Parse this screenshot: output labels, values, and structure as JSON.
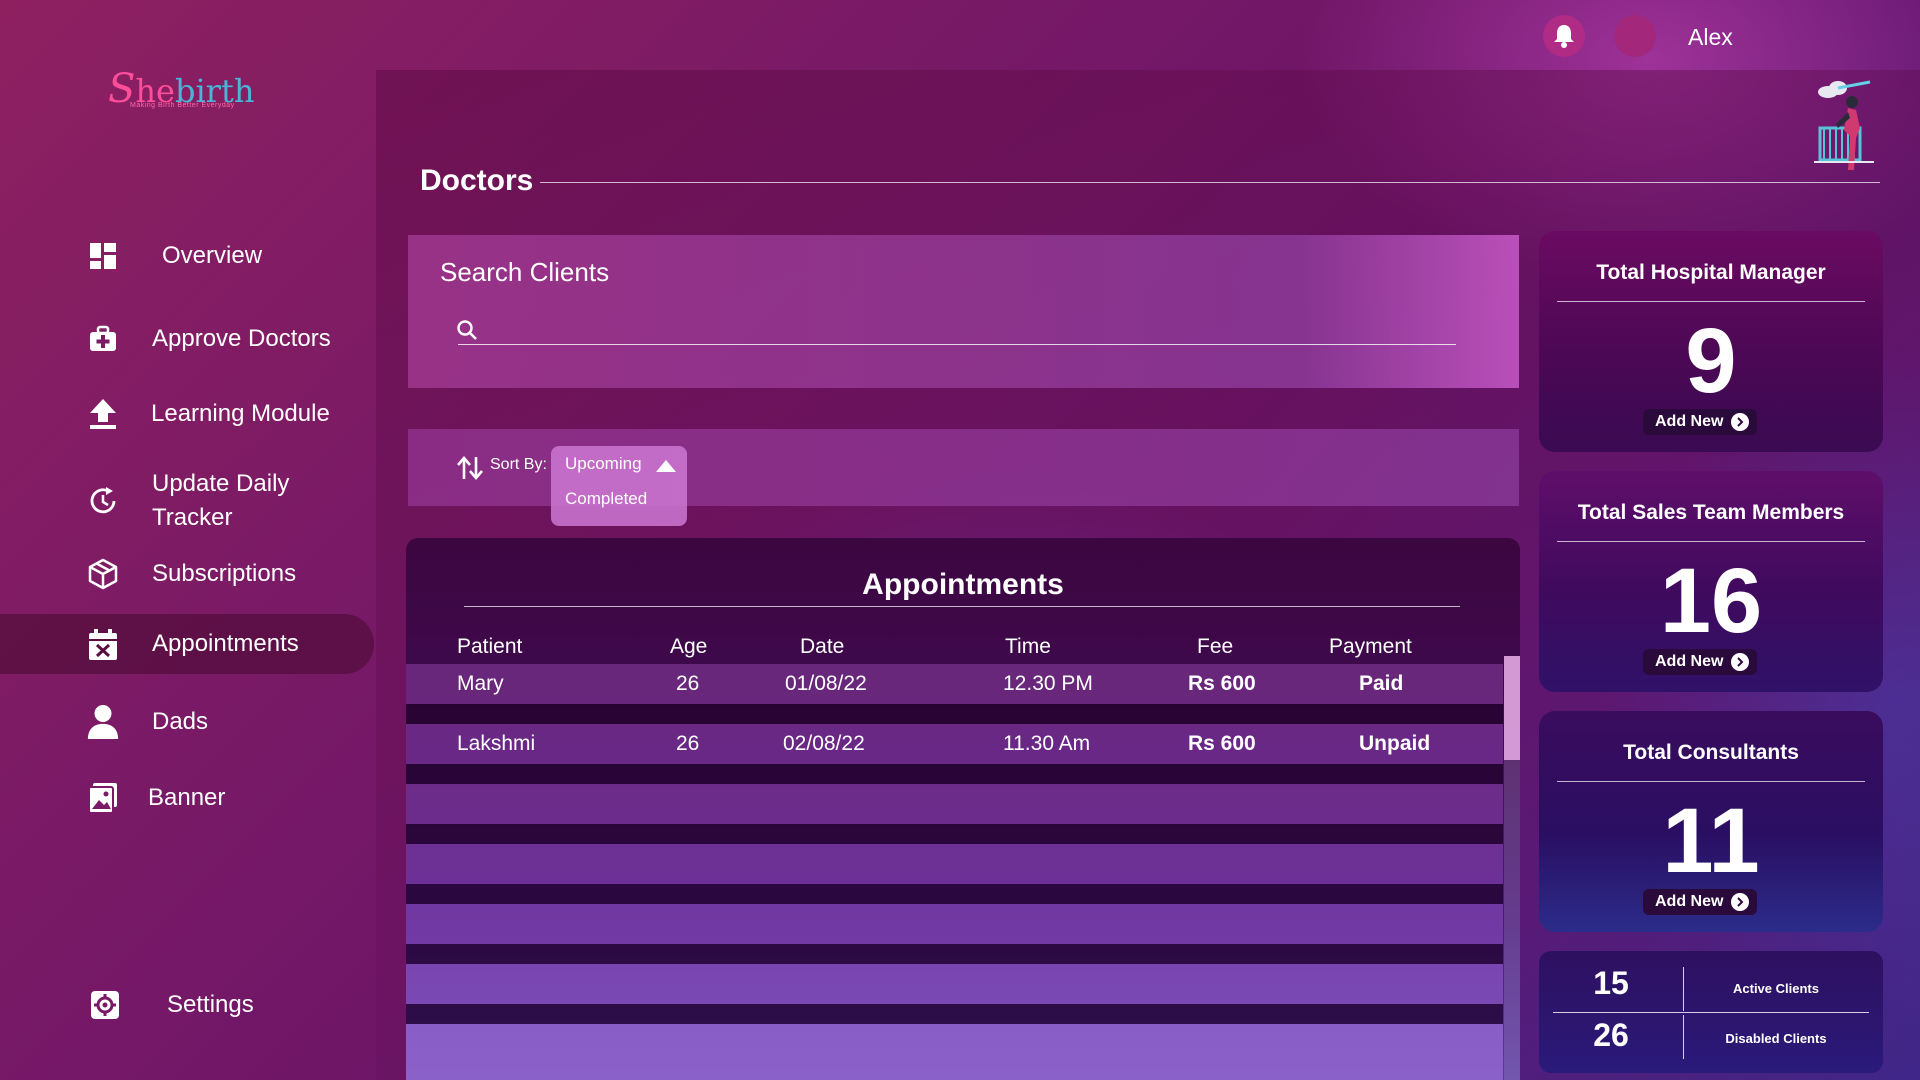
{
  "header": {
    "username": "Alex",
    "bell_icon": "bell-icon",
    "avatar_color": "#a3277b"
  },
  "brand": {
    "logo_s": "S",
    "logo_he": "he",
    "logo_birth": "birth",
    "tagline": "Making Birth Better Everyday"
  },
  "sidebar": {
    "items": [
      {
        "label": "Overview",
        "icon": "grid-icon"
      },
      {
        "label": "Approve Doctors",
        "icon": "medical-kit-icon"
      },
      {
        "label": "Learning Module",
        "icon": "upload-icon"
      },
      {
        "label": "Update Daily Tracker",
        "icon": "refresh-clock-icon"
      },
      {
        "label": "Subscriptions",
        "icon": "package-icon"
      },
      {
        "label": "Appointments",
        "icon": "calendar-x-icon",
        "active": true
      },
      {
        "label": "Dads",
        "icon": "user-icon"
      },
      {
        "label": "Banner",
        "icon": "image-icon"
      }
    ],
    "settings_label": "Settings"
  },
  "page": {
    "title": "Doctors"
  },
  "search": {
    "title": "Search Clients",
    "placeholder": ""
  },
  "sort": {
    "label": "Sort By:",
    "options": [
      "Upcoming",
      "Completed"
    ],
    "selected": "Upcoming"
  },
  "appointments": {
    "title": "Appointments",
    "columns": [
      "Patient",
      "Age",
      "Date",
      "Time",
      "Fee",
      "Payment"
    ],
    "rows": [
      {
        "patient": "Mary",
        "age": "26",
        "date": "01/08/22",
        "time": "12.30 PM",
        "fee": "Rs 600",
        "payment": "Paid"
      },
      {
        "patient": "Lakshmi",
        "age": "26",
        "date": "02/08/22",
        "time": "11.30 Am",
        "fee": "Rs 600",
        "payment": "Unpaid"
      }
    ]
  },
  "stats": [
    {
      "title": "Total Hospital Manager",
      "value": "9",
      "action": "Add New"
    },
    {
      "title": "Total Sales Team Members",
      "value": "16",
      "action": "Add New"
    },
    {
      "title": "Total Consultants",
      "value": "11",
      "action": "Add New"
    }
  ],
  "clients": {
    "active_count": "15",
    "active_label": "Active Clients",
    "disabled_count": "26",
    "disabled_label": "Disabled Clients"
  },
  "colors": {
    "accent_pink": "#ff4d9a",
    "logo_blue": "#49b6d8",
    "sidebar_active": "#460a2d"
  }
}
